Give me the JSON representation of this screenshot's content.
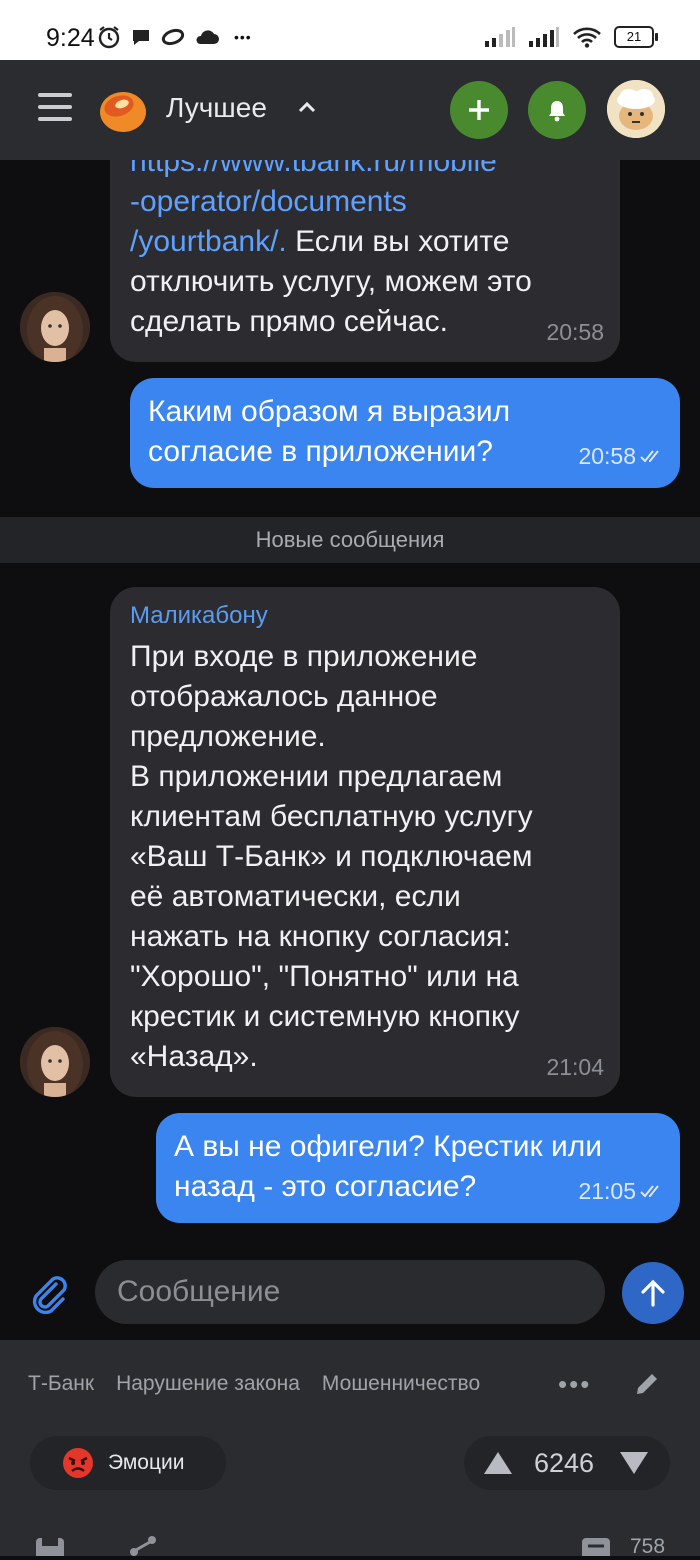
{
  "status_bar": {
    "time": "9:24",
    "battery": "21",
    "overflow": "•••"
  },
  "header": {
    "feed_title": "Лучшее",
    "accent": "#4a8a2e"
  },
  "chat": {
    "messages": [
      {
        "direction": "in",
        "link_lines": [
          "https://www.tbank.ru/mobile",
          "-operator/documents",
          "/yourtbank/."
        ],
        "text_after_link": " Если вы хотите",
        "lines": [
          "отключить услугу, можем это",
          "сделать прямо сейчас."
        ],
        "time": "20:58"
      },
      {
        "direction": "out",
        "lines": [
          "Каким образом я выразил",
          "согласие в приложении?"
        ],
        "time": "20:58"
      },
      {
        "direction": "in",
        "sender": "Маликабону",
        "lines": [
          "При входе в приложение",
          "отображалось данное",
          "предложение.",
          "В приложении предлагаем",
          "клиентам бесплатную услугу",
          "«Ваш Т-Банк» и подключаем",
          "её автоматически, если",
          "нажать на кнопку согласия:",
          "\"Хорошо\", \"Понятно\" или на",
          "крестик и системную кнопку",
          "«Назад»."
        ],
        "time": "21:04"
      },
      {
        "direction": "out",
        "lines": [
          "А вы не офигели? Крестик или",
          "назад - это согласие?"
        ],
        "time": "21:05"
      }
    ],
    "new_messages_divider": "Новые сообщения"
  },
  "composer": {
    "placeholder": "Сообщение"
  },
  "post": {
    "tags": [
      "Т-Банк",
      "Нарушение закона",
      "Мошенничество"
    ],
    "more": "•••",
    "emotions_label": "Эмоции",
    "rating": "6246",
    "comments_count": "758"
  }
}
